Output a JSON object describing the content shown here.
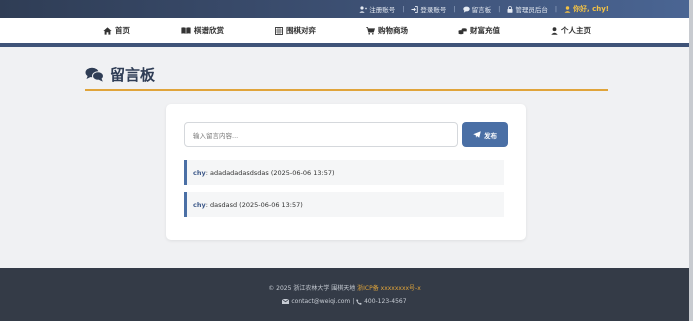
{
  "topbar": {
    "register": "注册账号",
    "login": "登录账号",
    "guestbook": "留言板",
    "admin": "管理员后台",
    "user": "你好, chy!"
  },
  "nav": {
    "home": "首页",
    "games": "棋谱欣赏",
    "play": "围棋对弈",
    "shop": "购物商场",
    "recharge": "财富充值",
    "profile": "个人主页"
  },
  "page": {
    "title": "留言板"
  },
  "form": {
    "placeholder": "输入留言内容...",
    "submit_label": "发布"
  },
  "messages": [
    {
      "author": "chy",
      "text": ": adadadadasdsdas (2025-06-06 13:57)"
    },
    {
      "author": "chy",
      "text": ": dasdasd (2025-06-06 13:57)"
    }
  ],
  "footer": {
    "copyright": "© 2025 浙江农林大学 围棋天地",
    "icp": "浙ICP备 xxxxxxxx号-x",
    "email": "contact@weiqi.com",
    "separator": "|",
    "phone": "400-123-4567"
  },
  "colors": {
    "accent": "#4a6fa5",
    "gold": "#e0a43a",
    "nav_dark": "#3f5378"
  }
}
